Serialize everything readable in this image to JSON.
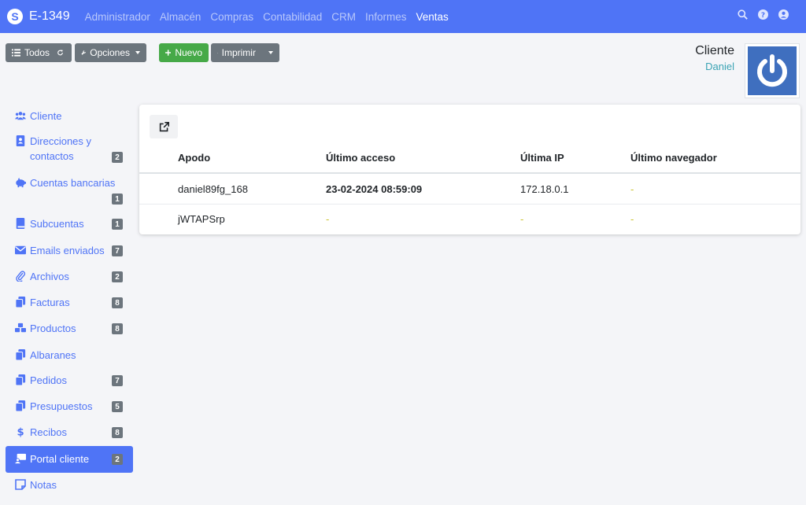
{
  "app": {
    "title": "E-1349",
    "menu": [
      "Administrador",
      "Almacén",
      "Compras",
      "Contabilidad",
      "CRM",
      "Informes",
      "Ventas"
    ],
    "active_menu": "Ventas"
  },
  "toolbar": {
    "todos_label": "Todos",
    "opciones_label": "Opciones",
    "nuevo_label": "Nuevo",
    "imprimir_label": "Imprimir"
  },
  "customer": {
    "label": "Cliente",
    "name": "Daniel"
  },
  "sidebar": {
    "items": [
      {
        "label": "Cliente",
        "icon": "users-icon",
        "badge": ""
      },
      {
        "label": "Direcciones y contactos",
        "icon": "address-book-icon",
        "badge": "2"
      },
      {
        "label": "Cuentas bancarias",
        "icon": "piggy-bank-icon",
        "badge": "1"
      },
      {
        "label": "Subcuentas",
        "icon": "book-icon",
        "badge": "1"
      },
      {
        "label": "Emails enviados",
        "icon": "envelope-icon",
        "badge": "7"
      },
      {
        "label": "Archivos",
        "icon": "paperclip-icon",
        "badge": "2"
      },
      {
        "label": "Facturas",
        "icon": "copy-icon",
        "badge": "8"
      },
      {
        "label": "Productos",
        "icon": "cubes-icon",
        "badge": "8"
      },
      {
        "label": "Albaranes",
        "icon": "copy-icon",
        "badge": ""
      },
      {
        "label": "Pedidos",
        "icon": "copy-icon",
        "badge": "7"
      },
      {
        "label": "Presupuestos",
        "icon": "copy-icon",
        "badge": "5"
      },
      {
        "label": "Recibos",
        "icon": "dollar-icon",
        "badge": "8"
      },
      {
        "label": "Portal cliente",
        "icon": "portal-icon",
        "badge": "2"
      },
      {
        "label": "Notas",
        "icon": "sticky-note-icon",
        "badge": ""
      }
    ],
    "active_index": 12
  },
  "table": {
    "columns": [
      "Apodo",
      "Último acceso",
      "Última IP",
      "Último navegador"
    ],
    "rows": [
      [
        "daniel89fg_168",
        "23-02-2024 08:59:09",
        "172.18.0.1",
        "-"
      ],
      [
        "jWTAPSrp",
        "-",
        "-",
        "-"
      ]
    ]
  },
  "colors": {
    "primary": "#4f74f6",
    "badge": "#6c757d",
    "success": "#46a948",
    "link_teal": "#3aa3b4",
    "dash": "#c9c12a"
  }
}
